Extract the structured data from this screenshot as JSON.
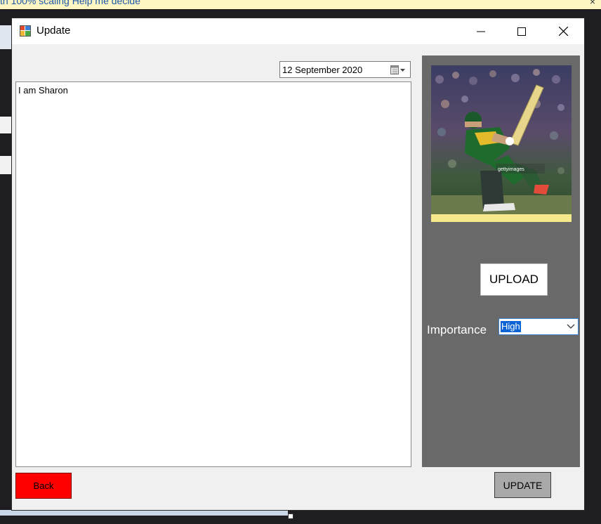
{
  "background": {
    "infobar_text": "th 100% scaling    Help me decide",
    "infobar_close": "×"
  },
  "window": {
    "title": "Update",
    "controls": {
      "minimize": "minimize-icon",
      "maximize": "maximize-icon",
      "close": "close-icon"
    }
  },
  "form": {
    "date_value": "12 September 2020",
    "description_text": "I am Sharon",
    "upload_label": "UPLOAD",
    "importance_label": "Importance",
    "importance_selected": "High",
    "back_label": "Back",
    "update_label": "UPDATE"
  },
  "image": {
    "subject": "cricket-batsman-photo",
    "watermark": "gettyimages"
  },
  "colors": {
    "panel": "#696969",
    "back_button": "#ff0000",
    "update_button": "#a9a9a9",
    "selection_highlight": "#0a64d6",
    "photo_border": "#f5e98b"
  }
}
